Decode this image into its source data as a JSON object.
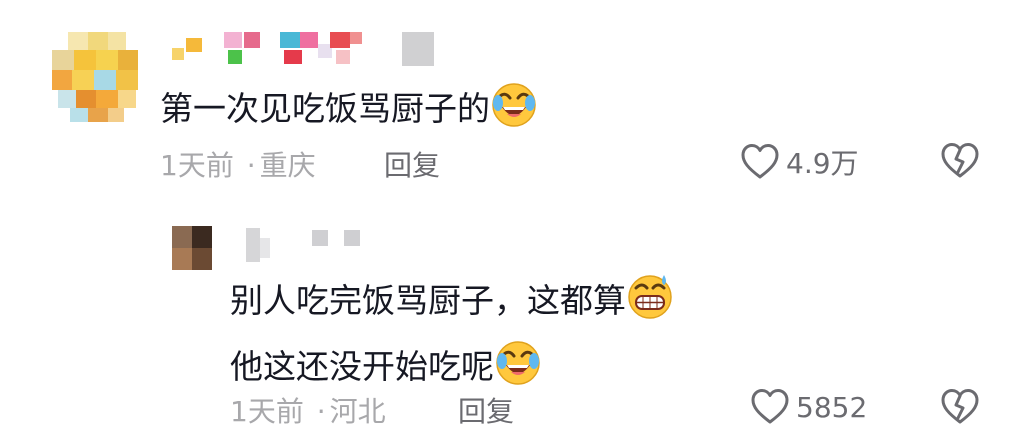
{
  "comments": [
    {
      "text": "第一次见吃饭骂厨子的",
      "emoji": "laughing-crying-emoji",
      "time": "1天前",
      "separator": "·",
      "location": "重庆",
      "reply_label": "回复",
      "likes": "4.9万"
    }
  ],
  "replies": [
    {
      "lines": [
        "别人吃完饭骂厨子，这都算",
        "他这还没开始吃呢"
      ],
      "emojis": [
        "grinning-sweat-emoji",
        "laughing-crying-emoji"
      ],
      "time": "1天前",
      "separator": "·",
      "location": "河北",
      "reply_label": "回复",
      "likes": "5852"
    }
  ],
  "icons": {
    "like": "heart-icon",
    "dislike": "broken-heart-icon"
  },
  "colors": {
    "text": "#161823",
    "meta": "#a8a8ab",
    "action": "#6b6b70",
    "emoji_yellow": "#ffc83d"
  }
}
